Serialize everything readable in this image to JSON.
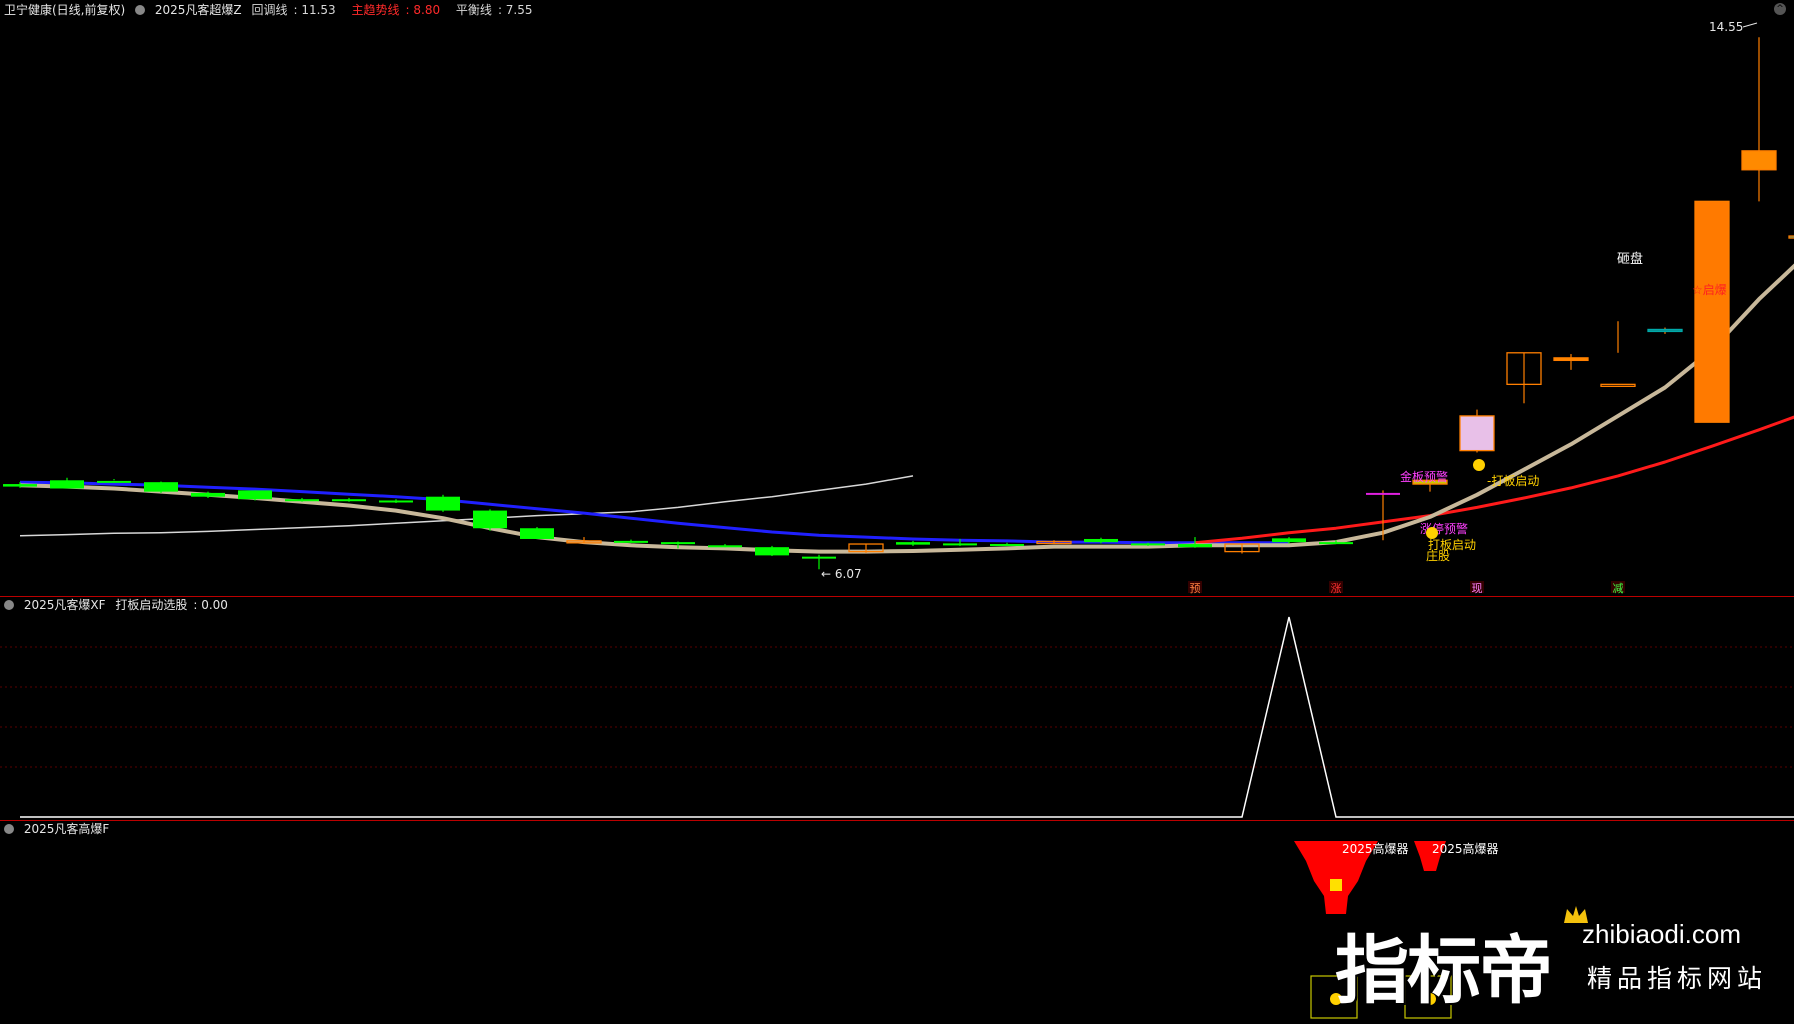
{
  "main": {
    "stock": "卫宁健康(日线,前复权)",
    "indicator": "2025凡客超爆Z",
    "pullback": {
      "label": "回调线",
      "value": "11.53",
      "color": "#d8d8d8"
    },
    "trend": {
      "label": "主趋势线",
      "value": "8.80",
      "color": "#ff2a2a"
    },
    "balance": {
      "label": "平衡线",
      "value": "7.55",
      "color": "#d8d8d8"
    }
  },
  "markers": {
    "high": "14.55",
    "low": "6.07",
    "zapan": "砸盘",
    "jinban": "金板预警",
    "daban": "打板启动",
    "zhuangshou": "庄股",
    "qibao": "启爆",
    "zhangting": "涨停",
    "yu": "预",
    "zhang": "涨",
    "xian": "现",
    "jian": "减"
  },
  "sub1": {
    "name": "2025凡客爆XF",
    "label": "打板启动选股",
    "value": "0.00"
  },
  "sub2": {
    "name": "2025凡客高爆F",
    "tag": "2025高爆器"
  },
  "watermark": {
    "cn": "指标帝",
    "url": "zhibiaodi.com",
    "slogan": "精品指标网站"
  },
  "colors": {
    "up": "#ff7f00",
    "down": "#00ff00",
    "trend": "#ff1a1a",
    "ma": "#2020ff",
    "slow": "#c8b89a"
  },
  "chart_data": {
    "type": "candlestick",
    "price_range": [
      5.9,
      14.9
    ],
    "candles": [
      [
        7.42,
        7.45,
        7.38,
        7.36
      ],
      [
        7.48,
        7.52,
        7.35,
        7.35
      ],
      [
        7.47,
        7.5,
        7.44,
        7.48
      ],
      [
        7.45,
        7.46,
        7.3,
        7.28
      ],
      [
        7.28,
        7.3,
        7.22,
        7.2
      ],
      [
        7.32,
        7.32,
        7.18,
        7.16
      ],
      [
        7.18,
        7.2,
        7.15,
        7.14
      ],
      [
        7.18,
        7.2,
        7.16,
        7.14
      ],
      [
        7.16,
        7.18,
        7.14,
        7.12
      ],
      [
        7.22,
        7.25,
        7.0,
        6.98
      ],
      [
        7.0,
        7.02,
        6.72,
        6.68
      ],
      [
        6.72,
        6.74,
        6.55,
        6.55
      ],
      [
        6.52,
        6.58,
        6.52,
        6.48
      ],
      [
        6.52,
        6.54,
        6.51,
        6.49
      ],
      [
        6.5,
        6.51,
        6.48,
        6.4
      ],
      [
        6.45,
        6.47,
        6.44,
        6.42
      ],
      [
        6.42,
        6.44,
        6.29,
        6.28
      ],
      [
        6.27,
        6.3,
        6.26,
        6.07
      ],
      [
        6.35,
        6.47,
        6.47,
        6.33
      ],
      [
        6.5,
        6.52,
        6.46,
        6.44
      ],
      [
        6.48,
        6.55,
        6.46,
        6.44
      ],
      [
        6.47,
        6.49,
        6.46,
        6.45
      ],
      [
        6.5,
        6.53,
        6.51,
        6.48
      ],
      [
        6.55,
        6.57,
        6.5,
        6.48
      ],
      [
        6.48,
        6.49,
        6.47,
        6.44
      ],
      [
        6.47,
        6.58,
        6.42,
        6.41
      ],
      [
        6.35,
        6.47,
        6.47,
        6.32
      ],
      [
        6.56,
        6.58,
        6.5,
        6.48
      ],
      [
        6.5,
        6.53,
        6.48,
        6.47
      ],
      [
        7.28,
        7.32,
        7.28,
        6.53
      ],
      [
        7.42,
        7.45,
        7.48,
        7.3
      ],
      [
        7.95,
        8.6,
        8.5,
        7.92
      ],
      [
        9.0,
        9.5,
        9.5,
        8.7
      ],
      [
        9.38,
        9.48,
        9.42,
        9.23
      ],
      [
        9.0,
        10.0,
        9.0,
        9.5
      ],
      [
        9.87,
        9.9,
        9.87,
        9.8
      ],
      [
        8.4,
        11.9,
        11.9,
        8.4
      ],
      [
        12.4,
        14.5,
        12.7,
        11.9
      ],
      [
        11.35,
        11.8,
        11.35,
        11.0
      ]
    ],
    "pullback_line": [
      7.4,
      7.38,
      7.35,
      7.3,
      7.25,
      7.2,
      7.14,
      7.08,
      7.0,
      6.88,
      6.72,
      6.58,
      6.5,
      6.45,
      6.42,
      6.4,
      6.37,
      6.35,
      6.35,
      6.36,
      6.38,
      6.4,
      6.43,
      6.43,
      6.43,
      6.45,
      6.45,
      6.45,
      6.5,
      6.65,
      6.9,
      7.25,
      7.65,
      8.05,
      8.5,
      8.95,
      9.55,
      10.35,
      11.05,
      11.53
    ],
    "ma_line": [
      7.45,
      7.44,
      7.42,
      7.4,
      7.37,
      7.34,
      7.3,
      7.26,
      7.22,
      7.17,
      7.1,
      7.03,
      6.96,
      6.88,
      6.8,
      6.73,
      6.66,
      6.61,
      6.58,
      6.55,
      6.53,
      6.52,
      6.5,
      6.5,
      6.49,
      6.49,
      6.49,
      6.49
    ],
    "trend_line": [
      6.49,
      6.56,
      6.65,
      6.72,
      6.82,
      6.92,
      7.05,
      7.2,
      7.36,
      7.55,
      7.77,
      8.02,
      8.28,
      8.55,
      8.8
    ],
    "balance_line": [
      6.6,
      6.62,
      6.64,
      6.65,
      6.67,
      6.7,
      6.73,
      6.76,
      6.8,
      6.84,
      6.88,
      6.92,
      6.95,
      6.98,
      7.05,
      7.14,
      7.22,
      7.32,
      7.42,
      7.55
    ],
    "xf_signal": [
      0,
      0,
      0,
      0,
      0,
      0,
      0,
      0,
      0,
      0,
      0,
      0,
      0,
      0,
      0,
      0,
      0,
      0,
      0,
      0,
      0,
      0,
      0,
      0,
      0,
      0,
      0,
      1,
      0,
      0,
      0,
      0,
      0,
      0,
      0,
      0,
      0,
      0,
      0,
      0
    ]
  }
}
